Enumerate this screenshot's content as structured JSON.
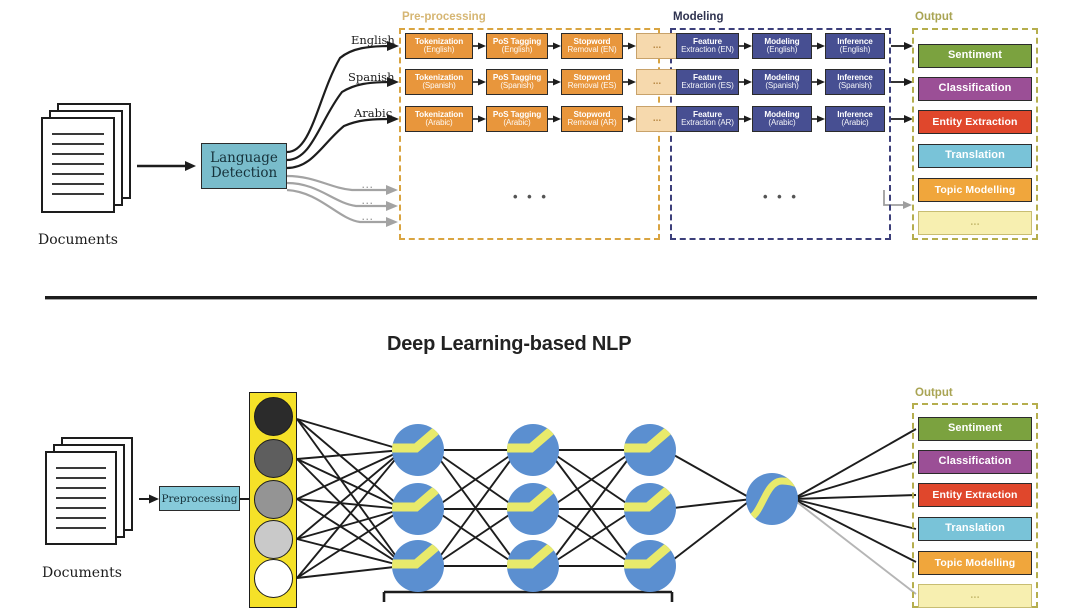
{
  "title": "Deep Learning-based NLP",
  "colors": {
    "preprocessing_box": "#e8963c",
    "modeling_box": "#474f92",
    "language_detection_box": "#79bccb",
    "preprocessing_small_box": "#86cada",
    "input_layer": "#f5e128",
    "neuron": "#5b8fd0",
    "activation_curve": "#e8ea6b",
    "group_pre_border": "#d9a441",
    "group_mod_border": "#3c3f7a",
    "group_out_border": "#b5ae4e"
  },
  "classic": {
    "documents_caption": "Documents",
    "language_detection": {
      "line1": "Language",
      "line2": "Detection"
    },
    "languages": [
      "English",
      "Spanish",
      "Arabic"
    ],
    "extra_language_rows": [
      "...",
      "...",
      "..."
    ],
    "groups": {
      "preprocessing_label": "Pre-processing",
      "modeling_label": "Modeling",
      "output_label": "Output"
    },
    "preprocessing_rows": [
      [
        {
          "line1": "Tokenization",
          "line2": "(English)"
        },
        {
          "line1": "PoS Tagging",
          "line2": "(English)"
        },
        {
          "line1": "Stopword",
          "line2": "Removal (EN)"
        },
        {
          "line1": "...",
          "line2": ""
        }
      ],
      [
        {
          "line1": "Tokenization",
          "line2": "(Spanish)"
        },
        {
          "line1": "PoS Tagging",
          "line2": "(Spanish)"
        },
        {
          "line1": "Stopword",
          "line2": "Removal (ES)"
        },
        {
          "line1": "...",
          "line2": ""
        }
      ],
      [
        {
          "line1": "Tokenization",
          "line2": "(Arabic)"
        },
        {
          "line1": "PoS Tagging",
          "line2": "(Arabic)"
        },
        {
          "line1": "Stopword",
          "line2": "Removal (AR)"
        },
        {
          "line1": "...",
          "line2": ""
        }
      ]
    ],
    "modeling_rows": [
      [
        {
          "line1": "Feature",
          "line2": "Extraction (EN)"
        },
        {
          "line1": "Modeling",
          "line2": "(English)"
        },
        {
          "line1": "Inference",
          "line2": "(English)"
        }
      ],
      [
        {
          "line1": "Feature",
          "line2": "Extraction (ES)"
        },
        {
          "line1": "Modeling",
          "line2": "(Spanish)"
        },
        {
          "line1": "Inference",
          "line2": "(Spanish)"
        }
      ],
      [
        {
          "line1": "Feature",
          "line2": "Extraction (AR)"
        },
        {
          "line1": "Modeling",
          "line2": "(Arabic)"
        },
        {
          "line1": "Inference",
          "line2": "(Arabic)"
        }
      ]
    ],
    "preprocessing_ellipsis": "• • •",
    "modeling_ellipsis": "• • •",
    "outputs": [
      {
        "label": "Sentiment",
        "color": "#7ba23f",
        "text_color": "#ffffff"
      },
      {
        "label": "Classification",
        "color": "#9b4f96",
        "text_color": "#ffffff"
      },
      {
        "label": "Entity Extraction",
        "color": "#e0472c",
        "text_color": "#ffffff"
      },
      {
        "label": "Translation",
        "color": "#79c3d8",
        "text_color": "#ffffff"
      },
      {
        "label": "Topic Modelling",
        "color": "#f0a63c",
        "text_color": "#ffffff"
      },
      {
        "label": "...",
        "color": "#f7 efb0",
        "text_color": "#c8bd72"
      }
    ]
  },
  "deep": {
    "documents_caption": "Documents",
    "preprocessing_label": "Preprocessing",
    "output_label": "Output",
    "input_nodes": [
      "#2b2b2b",
      "#5e5e5e",
      "#949494",
      "#c9c9c9",
      "#ffffff"
    ],
    "hidden_layers": 3,
    "neurons_per_layer": 3,
    "activation_hidden": "relu-icon",
    "activation_output": "sigmoid-icon",
    "outputs": [
      {
        "label": "Sentiment",
        "color": "#7ba23f",
        "text_color": "#ffffff"
      },
      {
        "label": "Classification",
        "color": "#9b4f96",
        "text_color": "#ffffff"
      },
      {
        "label": "Entity Extraction",
        "color": "#e0472c",
        "text_color": "#ffffff"
      },
      {
        "label": "Translation",
        "color": "#79c3d8",
        "text_color": "#ffffff"
      },
      {
        "label": "Topic Modelling",
        "color": "#f0a63c",
        "text_color": "#ffffff"
      },
      {
        "label": "...",
        "color": "#f7efb0",
        "text_color": "#c8bd72"
      }
    ]
  }
}
